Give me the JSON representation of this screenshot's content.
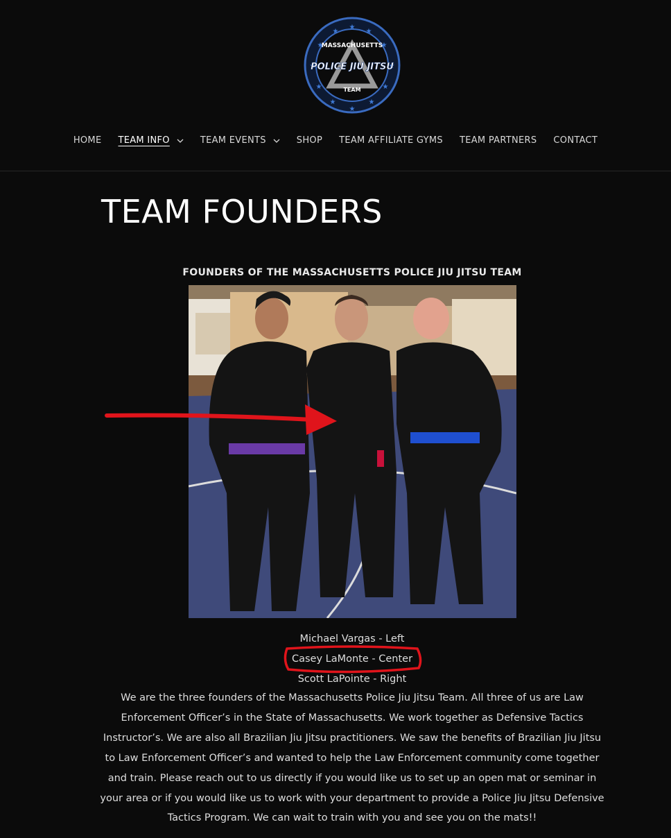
{
  "logo": {
    "top_text": "MASSACHUSETTS",
    "main_text": "POLICE JIU JITSU",
    "bottom_text": "TEAM"
  },
  "nav": {
    "items": [
      {
        "label": "HOME"
      },
      {
        "label": "TEAM INFO",
        "has_dropdown": true,
        "active": true
      },
      {
        "label": "TEAM EVENTS",
        "has_dropdown": true
      },
      {
        "label": "SHOP"
      },
      {
        "label": "TEAM AFFILIATE GYMS"
      },
      {
        "label": "TEAM PARTNERS"
      },
      {
        "label": "CONTACT"
      }
    ]
  },
  "page": {
    "title": "TEAM FOUNDERS",
    "photo_caption": "FOUNDERS OF THE MASSACHUSETTS POLICE JIU JITSU TEAM",
    "names": [
      "Michael Vargas - Left",
      "Casey LaMonte - Center",
      "Scott LaPointe - Right"
    ],
    "body": "We are the three founders of the Massachusetts Police Jiu Jitsu Team. All three of us are Law Enforcement Officer’s in the State of Massachusetts. We work together as Defensive Tactics Instructor’s. We are also all Brazilian Jiu Jitsu practitioners. We saw the benefits of Brazilian Jiu Jitsu to Law Enforcement Officer’s and wanted to help the Law Enforcement community come together and train. Please reach out to us directly if you would like us to set up an open mat or seminar in your area or if you would like us to work with your department to provide a Police Jiu Jitsu Defensive Tactics Program. We can wait to train with you and see you on the mats!!"
  },
  "colors": {
    "background": "#0b0b0b",
    "logo_blue": "#2e5ea8",
    "annotation_red": "#e0141b",
    "purple_belt": "#6a3aa6",
    "blue_belt": "#1f4fd0"
  }
}
